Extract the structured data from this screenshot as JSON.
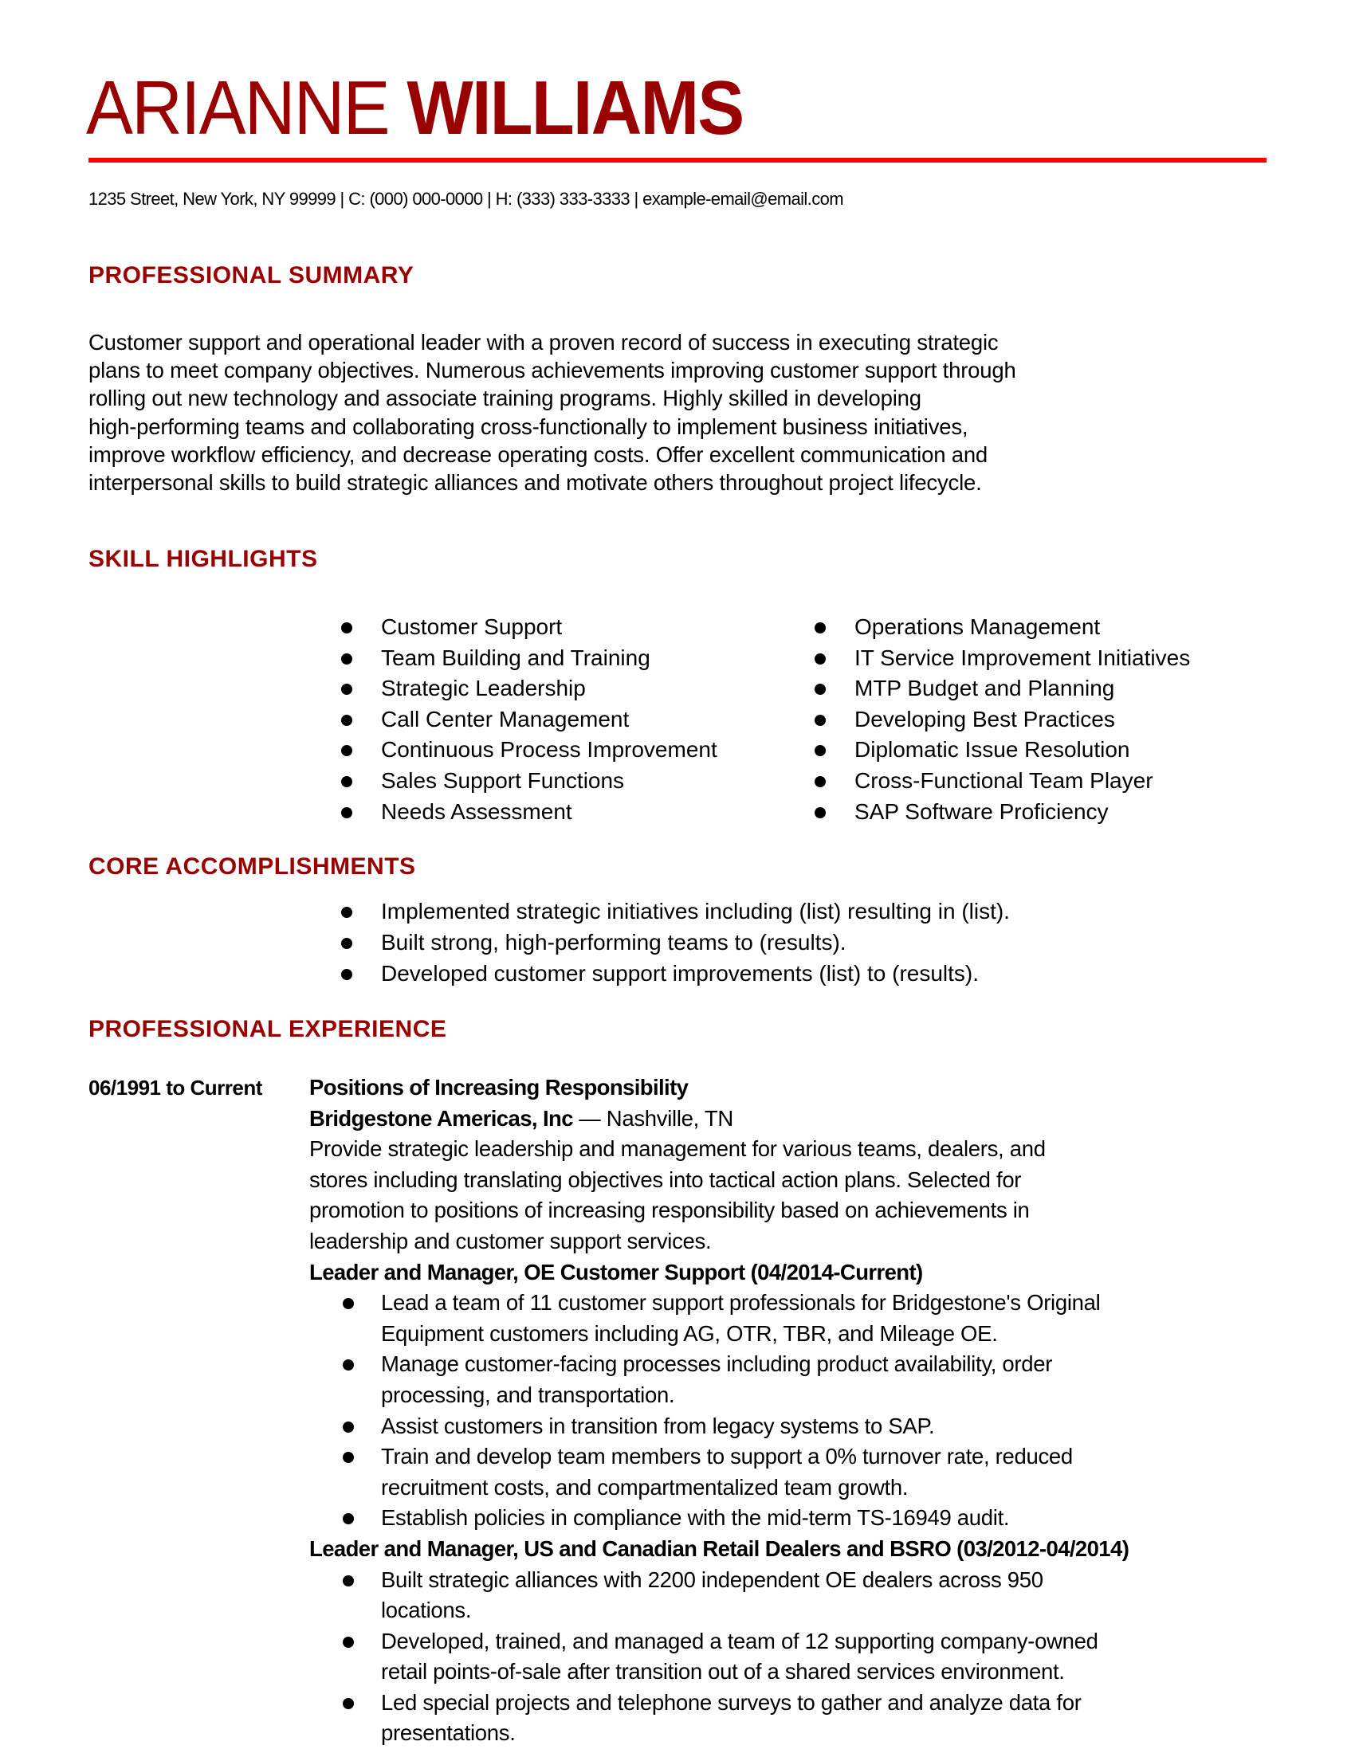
{
  "header": {
    "first_name": "ARIANNE",
    "last_name": "WILLIAMS",
    "accent_color": "#990000",
    "rule_color": "#ff0000",
    "contact": "1235 Street, New York, NY 99999 | C: (000) 000-0000 | H: (333) 333-3333 | example-email@email.com"
  },
  "sections": {
    "summary": {
      "heading": "PROFESSIONAL SUMMARY",
      "lines": [
        "Customer support and operational leader with a proven record of success in executing strategic",
        "plans to meet company objectives. Numerous achievements improving customer support through",
        "rolling out new technology and associate training programs. Highly skilled in developing",
        "high-performing teams and collaborating cross-functionally to implement business initiatives,",
        "improve workflow efficiency, and decrease operating costs. Offer excellent communication and",
        "interpersonal skills to build strategic alliances and motivate others throughout project lifecycle."
      ]
    },
    "skills": {
      "heading": "SKILL HIGHLIGHTS",
      "left": [
        "Customer Support",
        "Team Building and Training",
        "Strategic Leadership",
        "Call Center Management",
        "Continuous Process Improvement",
        "Sales Support Functions",
        "Needs Assessment"
      ],
      "right": [
        "Operations Management",
        "IT Service Improvement Initiatives",
        "MTP Budget and Planning",
        "Developing Best Practices",
        "Diplomatic Issue Resolution",
        "Cross-Functional Team Player",
        "SAP Software Proficiency"
      ]
    },
    "accomplishments": {
      "heading": "CORE ACCOMPLISHMENTS",
      "items": [
        "Implemented strategic initiatives including (list) resulting in (list).",
        "Built strong, high-performing teams to (results).",
        "Developed customer support improvements (list) to (results)."
      ]
    },
    "experience": {
      "heading": "PROFESSIONAL EXPERIENCE",
      "jobs": [
        {
          "dates": "06/1991 to Current",
          "title": "Positions of Increasing Responsibility",
          "company": "Bridgestone Americas, Inc",
          "separator": " — ",
          "location": "Nashville, TN",
          "description_lines": [
            "Provide strategic leadership and management for various teams, dealers, and",
            "stores including translating objectives into tactical action plans. Selected for",
            "promotion to positions of increasing responsibility based on achievements in",
            "leadership and customer support services."
          ],
          "roles": [
            {
              "title": "Leader and Manager, OE Customer Support (04/2014-Current)",
              "bullets": [
                [
                  "Lead a team of 11 customer support professionals for Bridgestone's Original",
                  "Equipment customers including AG, OTR, TBR, and Mileage OE."
                ],
                [
                  "Manage customer-facing processes including product availability, order",
                  "processing, and transportation."
                ],
                [
                  "Assist customers in transition from legacy systems to SAP."
                ],
                [
                  "Train and develop team members to support a 0% turnover rate, reduced",
                  "recruitment costs, and compartmentalized team growth."
                ],
                [
                  "Establish policies in compliance with the mid-term TS-16949 audit."
                ]
              ]
            },
            {
              "title": "Leader and Manager, US and Canadian Retail Dealers and BSRO (03/2012-04/2014)",
              "bullets": [
                [
                  "Built strategic alliances with 2200 independent OE dealers across 950",
                  "locations."
                ],
                [
                  "Developed, trained, and managed a team of 12 supporting company-owned",
                  "retail points-of-sale after transition out of a shared services environment."
                ],
                [
                  "Led special projects and telephone surveys to gather and analyze data for",
                  "presentations."
                ]
              ]
            }
          ]
        }
      ]
    }
  }
}
